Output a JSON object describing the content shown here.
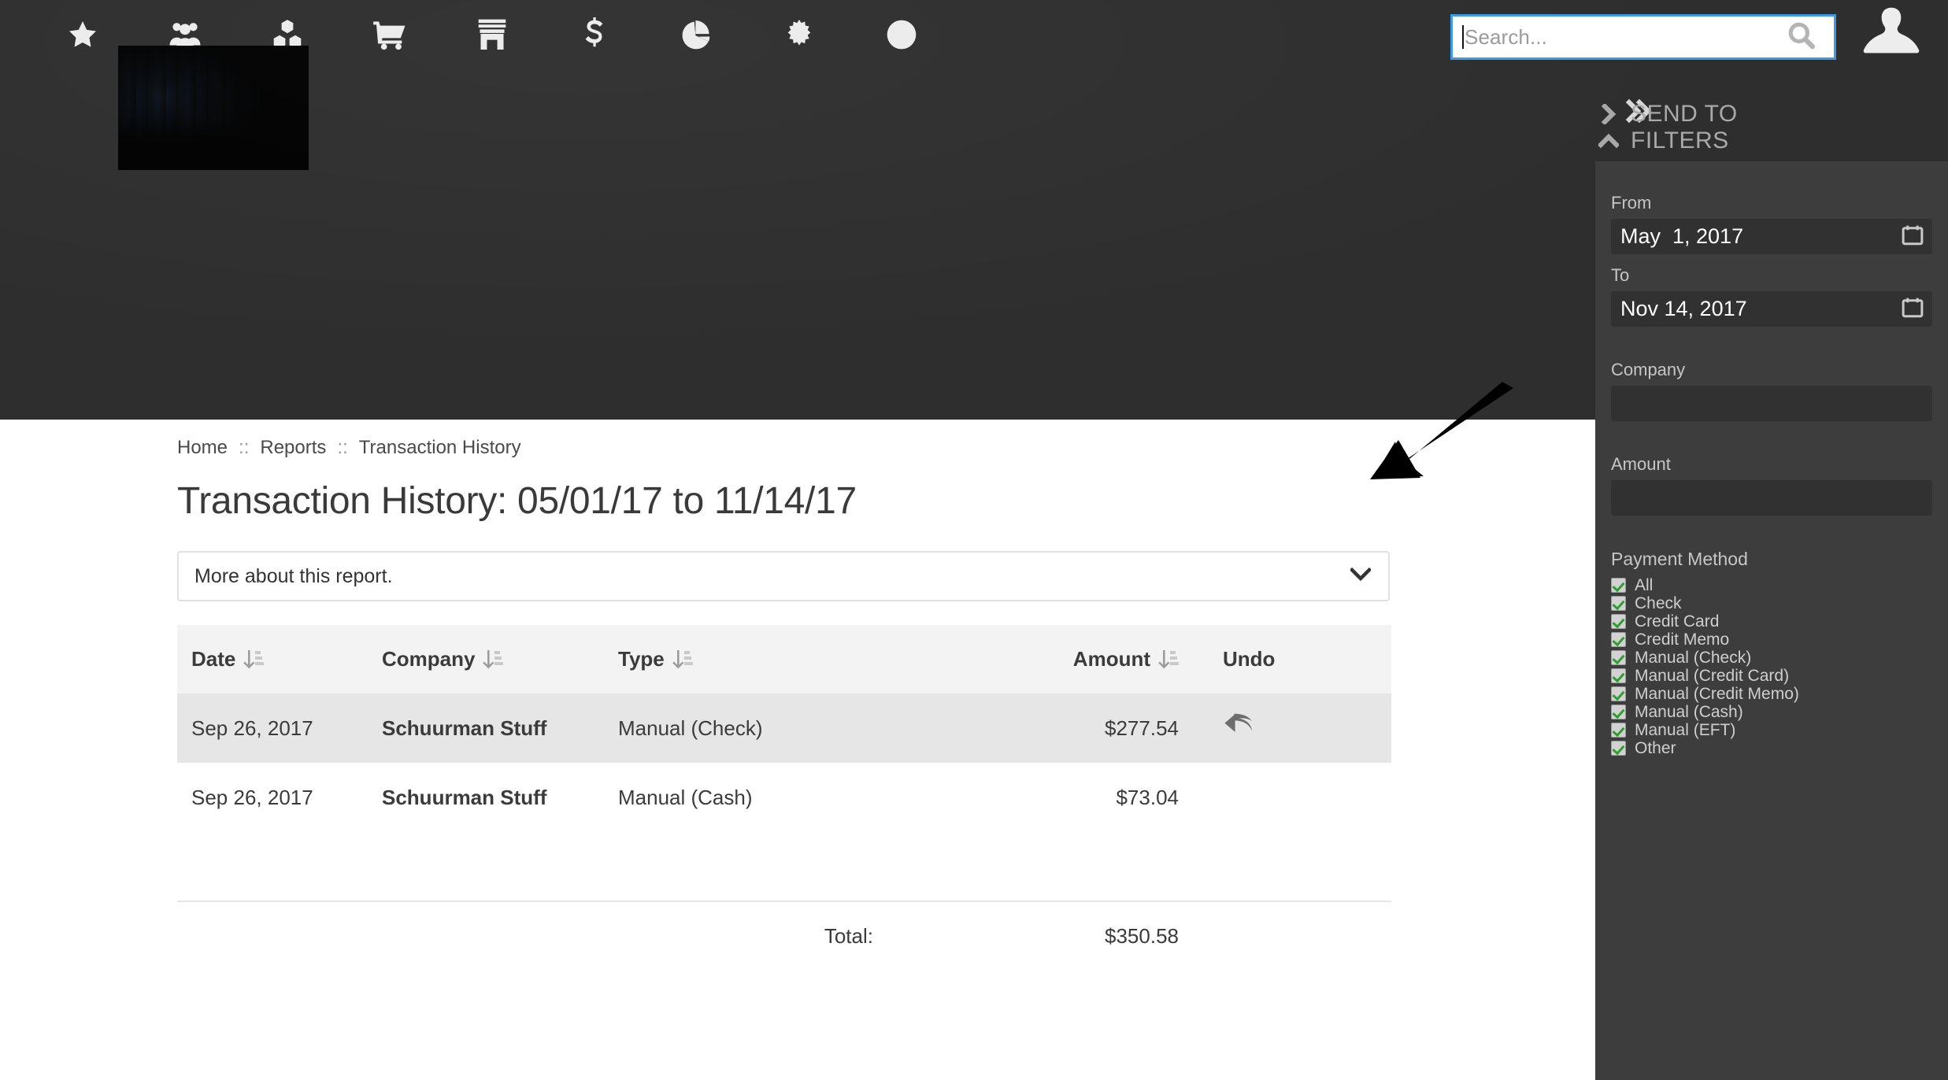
{
  "header": {
    "toolbar_icons": [
      {
        "name": "star-icon",
        "label": "Favorites"
      },
      {
        "name": "users-icon",
        "label": "Customers"
      },
      {
        "name": "cubes-icon",
        "label": "Inventory"
      },
      {
        "name": "shopping-cart-icon",
        "label": "Orders"
      },
      {
        "name": "store-icon",
        "label": "Store"
      },
      {
        "name": "dollar-icon",
        "label": "Payments"
      },
      {
        "name": "pie-chart-icon",
        "label": "Reports"
      },
      {
        "name": "gear-icon",
        "label": "Settings"
      },
      {
        "name": "question-circle-icon",
        "label": "Help"
      }
    ],
    "search": {
      "placeholder": "Search...",
      "value": "",
      "icon": "search-icon"
    },
    "avatar": {
      "icon": "avatar-icon"
    },
    "banner": {
      "name": "site-logo-banner"
    },
    "accent_color": "#3b99e8",
    "background_color": "#2e2e2e"
  },
  "sidebar": {
    "expand_icon": "double-chevron-right-icon",
    "sections": [
      {
        "label": "SEND TO",
        "collapsed": true,
        "icon": "chevron-right-icon"
      },
      {
        "label": "FILTERS",
        "collapsed": false,
        "icon": "chevron-up-icon"
      }
    ],
    "filters": {
      "from": {
        "label": "From",
        "value": "May  1, 2017",
        "icon": "calendar-icon"
      },
      "to": {
        "label": "To",
        "value": "Nov 14, 2017",
        "icon": "calendar-icon"
      },
      "company": {
        "label": "Company",
        "value": "",
        "placeholder": ""
      },
      "amount": {
        "label": "Amount",
        "value": "",
        "placeholder": ""
      },
      "payment_method": {
        "label": "Payment Method",
        "options": [
          {
            "label": "All",
            "checked": true
          },
          {
            "label": "Check",
            "checked": true
          },
          {
            "label": "Credit Card",
            "checked": true
          },
          {
            "label": "Credit Memo",
            "checked": true
          },
          {
            "label": "Manual (Check)",
            "checked": true
          },
          {
            "label": "Manual (Credit Card)",
            "checked": true
          },
          {
            "label": "Manual (Credit Memo)",
            "checked": true
          },
          {
            "label": "Manual (Cash)",
            "checked": true
          },
          {
            "label": "Manual (EFT)",
            "checked": true
          },
          {
            "label": "Other",
            "checked": true
          }
        ],
        "check_color": "#2da02d"
      }
    },
    "panel_background": "#3d3d3d"
  },
  "main": {
    "breadcrumb": [
      {
        "label": "Home",
        "link": true
      },
      {
        "label": "Reports",
        "link": true
      },
      {
        "label": "Transaction History",
        "link": false
      }
    ],
    "breadcrumb_separator": "::",
    "page_title": "Transaction History: 05/01/17 to 11/14/17",
    "accordion": {
      "label": "More about this report.",
      "icon": "chevron-down-icon",
      "expanded": false
    },
    "table": {
      "columns": [
        {
          "key": "date",
          "label": "Date",
          "sortable": true,
          "align": "left"
        },
        {
          "key": "company",
          "label": "Company",
          "sortable": true,
          "align": "left"
        },
        {
          "key": "type",
          "label": "Type",
          "sortable": true,
          "align": "left"
        },
        {
          "key": "amount",
          "label": "Amount",
          "sortable": true,
          "align": "right"
        },
        {
          "key": "undo",
          "label": "Undo",
          "sortable": false,
          "align": "left"
        }
      ],
      "rows": [
        {
          "date": "Sep 26, 2017",
          "company": "Schuurman Stuff",
          "type": "Manual (Check)",
          "amount": "$277.54",
          "undo_icon": "undo-arrow-icon",
          "has_undo": true,
          "highlighted": true
        },
        {
          "date": "Sep 26, 2017",
          "company": "Schuurman Stuff",
          "type": "Manual (Cash)",
          "amount": "$73.04",
          "undo_icon": "",
          "has_undo": false,
          "highlighted": false
        }
      ],
      "total_label": "Total:",
      "total_value": "$350.58",
      "sort_icon": "sort-descending-icon",
      "highlight_color": "#e6e6e6",
      "header_background": "#f3f3f3"
    }
  },
  "annotation": {
    "name": "pointer-arrow",
    "points_to": "undo-arrow-icon",
    "color": "#000000"
  }
}
